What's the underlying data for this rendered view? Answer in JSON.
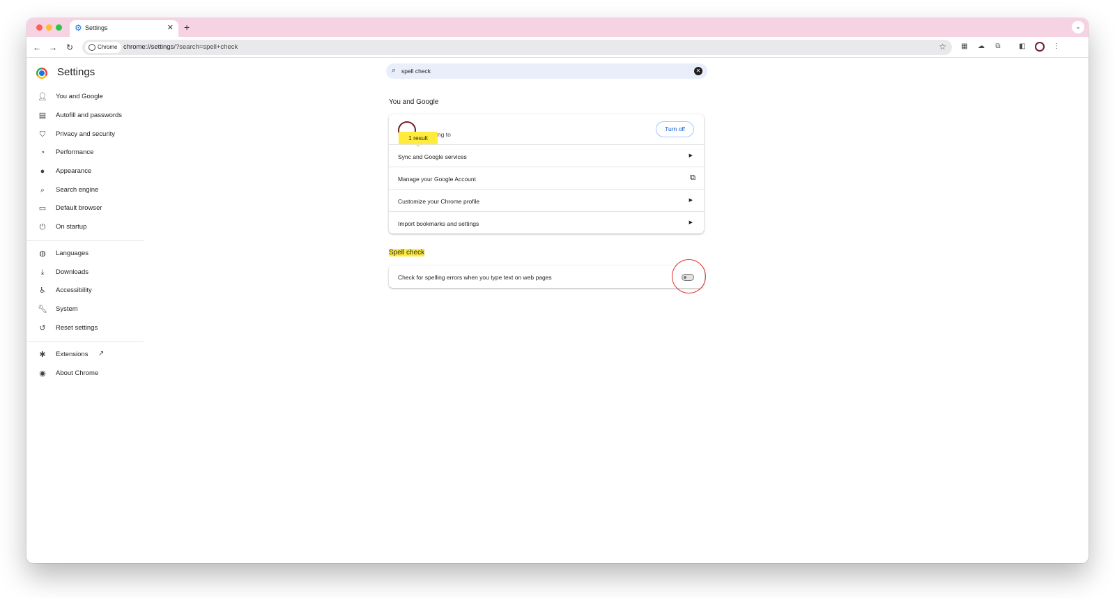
{
  "browser": {
    "tab_title": "Settings",
    "new_tab": "+",
    "close": "✕",
    "chip_label": "Chrome",
    "url_strong": "chrome://settings",
    "url_rest": "/?search=spell+check"
  },
  "sidebar": {
    "title": "Settings",
    "items": [
      {
        "label": "You and Google",
        "icon": "person-icon"
      },
      {
        "label": "Autofill and passwords",
        "icon": "clipboard-icon"
      },
      {
        "label": "Privacy and security",
        "icon": "shield-icon"
      },
      {
        "label": "Performance",
        "icon": "speedometer-icon"
      },
      {
        "label": "Appearance",
        "icon": "palette-icon"
      },
      {
        "label": "Search engine",
        "icon": "search-icon"
      },
      {
        "label": "Default browser",
        "icon": "browser-icon"
      },
      {
        "label": "On startup",
        "icon": "power-icon"
      },
      {
        "label": "Languages",
        "icon": "globe-icon"
      },
      {
        "label": "Downloads",
        "icon": "download-icon"
      },
      {
        "label": "Accessibility",
        "icon": "accessibility-icon"
      },
      {
        "label": "System",
        "icon": "wrench-icon"
      },
      {
        "label": "Reset settings",
        "icon": "history-icon"
      },
      {
        "label": "Extensions",
        "icon": "puzzle-icon"
      },
      {
        "label": "About Chrome",
        "icon": "chrome-icon"
      }
    ]
  },
  "search": {
    "value": "spell check"
  },
  "you_and_google": {
    "title": "You and Google",
    "sync_text": "ing to",
    "result_badge": "1 result",
    "turn_off": "Turn off",
    "rows": [
      "Sync and Google services",
      "Manage your Google Account",
      "Customize your Chrome profile",
      "Import bookmarks and settings"
    ]
  },
  "spell_check": {
    "title": "Spell check",
    "row_label": "Check for spelling errors when you type text on web pages",
    "enabled": false
  },
  "colors": {
    "tabstrip": "#f6d3e3",
    "highlight": "#ffeb3b",
    "accent": "#0b57d0",
    "annotation_ring": "#e0302a"
  }
}
